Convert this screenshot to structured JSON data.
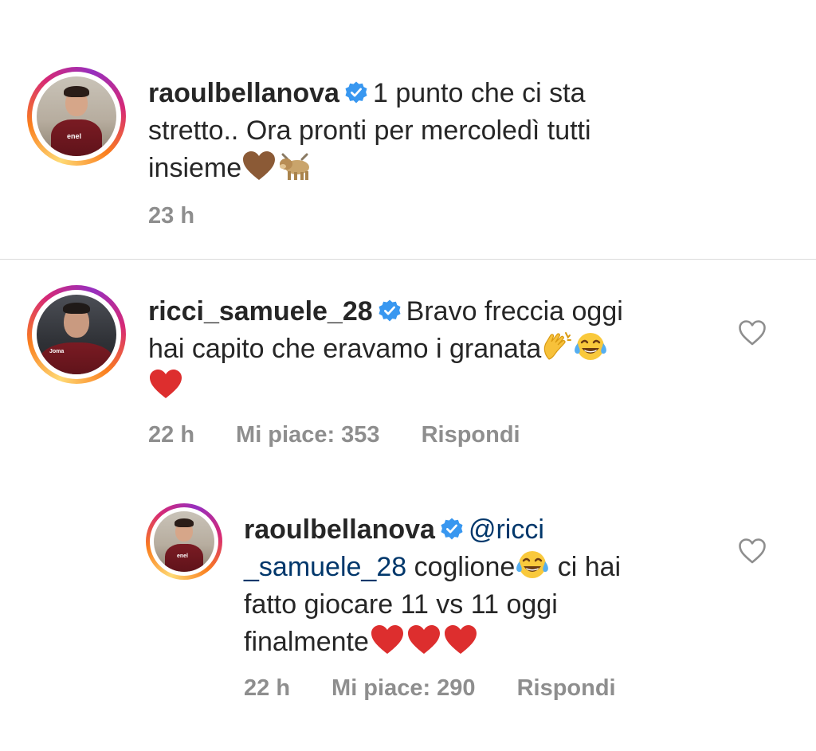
{
  "comments": [
    {
      "username": "raoulbellanova",
      "verified": true,
      "text_lines": [
        "1 punto che ci sta",
        "stretto.. Ora pronti per mercoledì tutti",
        "insieme"
      ],
      "emojis": [
        "brown-heart",
        "ox"
      ],
      "time": "23 h"
    },
    {
      "username": "ricci_samuele_28",
      "verified": true,
      "text_lines": [
        "Bravo freccia oggi",
        "hai capito che eravamo i granata"
      ],
      "emojis": [
        "clapping-hands",
        "tears-of-joy",
        "red-heart"
      ],
      "time": "22 h",
      "likes": "Mi piace: 353",
      "reply_label": "Rispondi"
    },
    {
      "username": "raoulbellanova",
      "verified": true,
      "mention_part1": "@ricci",
      "mention_part2": "_samuele_28",
      "text_lines": [
        "coglione",
        "ci hai",
        "fatto giocare 11 vs 11 oggi",
        "finalmente"
      ],
      "emojis": [
        "tears-of-joy",
        "red-heart",
        "red-heart",
        "red-heart"
      ],
      "time": "22 h",
      "likes": "Mi piace: 290",
      "reply_label": "Rispondi"
    }
  ],
  "colors": {
    "text": "#262626",
    "meta": "#8e8e8e",
    "mention": "#00376b",
    "verified": "#3897f0",
    "divider": "#dbdbdb"
  }
}
